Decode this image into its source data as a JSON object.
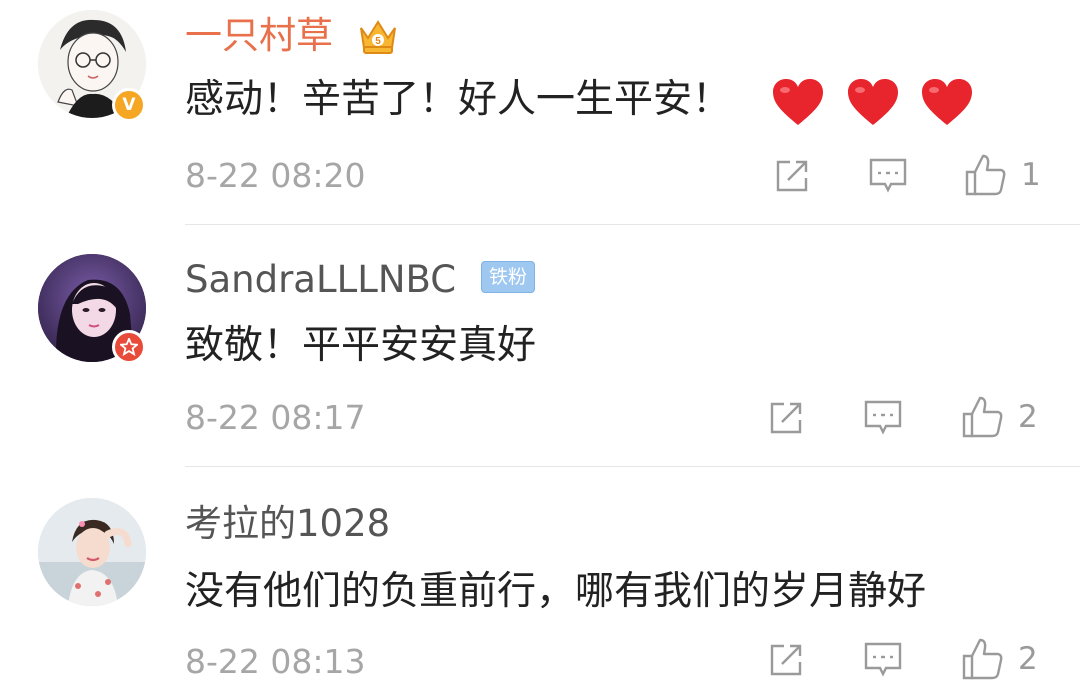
{
  "comments": [
    {
      "username": "一只村草",
      "username_color": "#e8704a",
      "text": "感动！辛苦了！好人一生平安！",
      "emoji": [
        "red-heart",
        "red-heart",
        "red-heart"
      ],
      "time": "8-22 08:20",
      "likes": "1",
      "badge": "verified-v",
      "badge_label": "V"
    },
    {
      "username": "SandraLLLNBC",
      "username_color": "#555555",
      "fan_badge": "铁粉",
      "text": "致敬！平平安安真好",
      "time": "8-22 08:17",
      "likes": "2",
      "badge": "star-badge"
    },
    {
      "username": "考拉的1028",
      "username_color": "#555555",
      "text": "没有他们的负重前行，哪有我们的岁月静好",
      "time": "8-22 08:13",
      "likes": "2"
    }
  ],
  "colors": {
    "heart": "#e8242c",
    "verified": "#f5a623",
    "star_badge": "#e84b3a",
    "fan_badge": "#9ec8f0"
  }
}
